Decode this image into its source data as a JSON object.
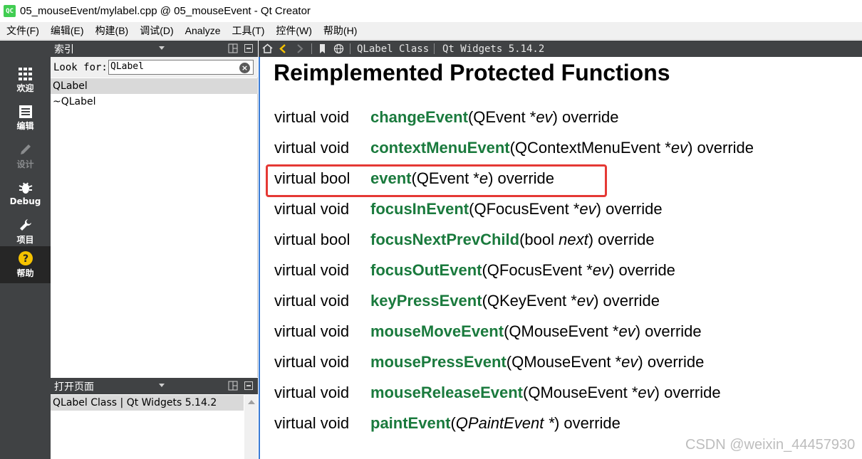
{
  "window": {
    "app_icon_text": "QC",
    "title": "05_mouseEvent/mylabel.cpp @ 05_mouseEvent - Qt Creator"
  },
  "menu": [
    "文件(F)",
    "编辑(E)",
    "构建(B)",
    "调试(D)",
    "Analyze",
    "工具(T)",
    "控件(W)",
    "帮助(H)"
  ],
  "modes": [
    {
      "label": "欢迎",
      "icon": "grid-icon",
      "state": "normal"
    },
    {
      "label": "编辑",
      "icon": "document-icon",
      "state": "normal"
    },
    {
      "label": "设计",
      "icon": "pencil-icon",
      "state": "disabled"
    },
    {
      "label": "Debug",
      "icon": "bug-icon",
      "state": "normal"
    },
    {
      "label": "项目",
      "icon": "wrench-icon",
      "state": "normal"
    },
    {
      "label": "帮助",
      "icon": "help-icon",
      "state": "active"
    }
  ],
  "index_pane": {
    "title": "索引",
    "look_for_label": "Look for:",
    "search_value": "QLabel",
    "items": [
      "QLabel",
      "~QLabel"
    ],
    "selected_index": 0
  },
  "open_pages_pane": {
    "title": "打开页面",
    "items": [
      "QLabel Class | Qt Widgets 5.14.2"
    ]
  },
  "help_toolbar": {
    "breadcrumb_page": "QLabel Class",
    "breadcrumb_module": "Qt Widgets 5.14.2"
  },
  "content": {
    "heading": "Reimplemented Protected Functions",
    "functions": [
      {
        "ret": "virtual void",
        "name": "changeEvent",
        "params": [
          {
            "t": "QEvent *",
            "i": false
          },
          {
            "t": "ev",
            "i": true
          }
        ],
        "suffix": ") override"
      },
      {
        "ret": "virtual void",
        "name": "contextMenuEvent",
        "params": [
          {
            "t": "QContextMenuEvent *",
            "i": false
          },
          {
            "t": "ev",
            "i": true
          }
        ],
        "suffix": ") override"
      },
      {
        "ret": "virtual bool",
        "name": "event",
        "params": [
          {
            "t": "QEvent *",
            "i": false
          },
          {
            "t": "e",
            "i": true
          }
        ],
        "suffix": ") override"
      },
      {
        "ret": "virtual void",
        "name": "focusInEvent",
        "params": [
          {
            "t": "QFocusEvent *",
            "i": false
          },
          {
            "t": "ev",
            "i": true
          }
        ],
        "suffix": ") override"
      },
      {
        "ret": "virtual bool",
        "name": "focusNextPrevChild",
        "params": [
          {
            "t": "bool ",
            "i": false
          },
          {
            "t": "next",
            "i": true
          }
        ],
        "suffix": ") override"
      },
      {
        "ret": "virtual void",
        "name": "focusOutEvent",
        "params": [
          {
            "t": "QFocusEvent *",
            "i": false
          },
          {
            "t": "ev",
            "i": true
          }
        ],
        "suffix": ") override"
      },
      {
        "ret": "virtual void",
        "name": "keyPressEvent",
        "params": [
          {
            "t": "QKeyEvent *",
            "i": false
          },
          {
            "t": "ev",
            "i": true
          }
        ],
        "suffix": ") override"
      },
      {
        "ret": "virtual void",
        "name": "mouseMoveEvent",
        "params": [
          {
            "t": "QMouseEvent *",
            "i": false
          },
          {
            "t": "ev",
            "i": true
          }
        ],
        "suffix": ") override"
      },
      {
        "ret": "virtual void",
        "name": "mousePressEvent",
        "params": [
          {
            "t": "QMouseEvent *",
            "i": false
          },
          {
            "t": "ev",
            "i": true
          }
        ],
        "suffix": ") override"
      },
      {
        "ret": "virtual void",
        "name": "mouseReleaseEvent",
        "params": [
          {
            "t": "QMouseEvent *",
            "i": false
          },
          {
            "t": "ev",
            "i": true
          }
        ],
        "suffix": ") override"
      },
      {
        "ret": "virtual void",
        "name": "paintEvent",
        "params": [
          {
            "t": "QPaintEvent *",
            "i": true
          }
        ],
        "suffix": ") override"
      }
    ],
    "highlighted_function": "event"
  },
  "watermark": "CSDN @weixin_44457930",
  "colors": {
    "function_name": "#1a7a3d",
    "highlight_box": "#e53935",
    "sidebar_bg": "#404244"
  }
}
